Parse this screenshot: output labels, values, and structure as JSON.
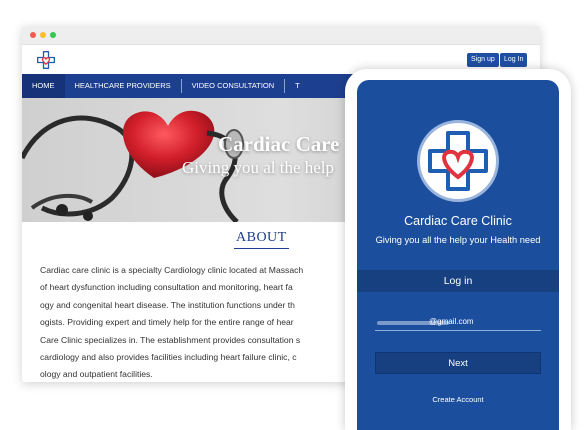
{
  "desktop": {
    "header": {
      "signup_label": "Sign up",
      "login_label": "Log In"
    },
    "nav": [
      {
        "label": "HOME",
        "active": true
      },
      {
        "label": "HEALTHCARE PROVIDERS"
      },
      {
        "label": "VIDEO CONSULTATION"
      },
      {
        "label": "T"
      }
    ],
    "hero": {
      "title": "Cardiac Care",
      "subtitle": "Giving you al the help"
    },
    "about": {
      "heading": "ABOUT",
      "lines": [
        "Cardiac care clinic is a specialty Cardiology clinic located at Massach",
        "of heart dysfunction including consultation and monitoring, heart fa",
        "ogy and congenital heart disease. The institution functions under th",
        "ogists. Providing expert and timely help for the entire range of hear",
        "Care Clinic specializes in. The establishment provides consultation s",
        "cardiology and also provides facilities including heart failure clinic, c",
        "ology and outpatient facilities."
      ]
    }
  },
  "mobile": {
    "app_title": "Cardiac Care Clinic",
    "app_subtitle": "Giving you all the help your Health need",
    "login_heading": "Log in",
    "email_domain": "@gmail.com",
    "next_label": "Next",
    "create_account_label": "Create Account"
  },
  "colors": {
    "brand_blue": "#1d3f8f",
    "screen_blue": "#1b4f9e",
    "heart_red": "#e0333f",
    "cross_blue": "#1f5fb3"
  },
  "icons": {
    "site_logo": "heart-cross-logo-icon",
    "app_logo": "heart-cross-logo-icon"
  }
}
